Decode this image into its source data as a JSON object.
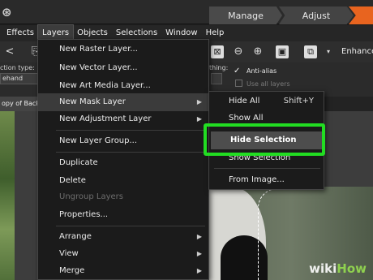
{
  "workspace_tabs": [
    "Manage",
    "Adjust",
    ""
  ],
  "menubar": [
    "Effects",
    "Layers",
    "Objects",
    "Selections",
    "Window",
    "Help"
  ],
  "toolbar": {
    "enhance_label": "Enhance"
  },
  "options": {
    "selection_type_label": "ction type:",
    "selection_type_value": "ehand",
    "things_label": "thing:",
    "anti_alias_label": "Anti-alias",
    "use_all_layers_label": "Use all layers"
  },
  "document_tab": "opy of Backg",
  "layers_menu": {
    "items": [
      {
        "label": "New Raster Layer..."
      },
      {
        "label": "New Vector Layer..."
      },
      {
        "label": "New Art Media Layer..."
      },
      {
        "label": "New Mask Layer",
        "submenu": true
      },
      {
        "label": "New Adjustment Layer",
        "submenu": true
      },
      {
        "label": "New Layer Group..."
      },
      {
        "label": "Duplicate"
      },
      {
        "label": "Delete"
      },
      {
        "label": "Ungroup Layers",
        "disabled": true
      },
      {
        "label": "Properties..."
      },
      {
        "label": "Arrange",
        "submenu": true
      },
      {
        "label": "View",
        "submenu": true
      },
      {
        "label": "Merge",
        "submenu": true
      }
    ]
  },
  "mask_submenu": {
    "items": [
      {
        "label": "Hide All",
        "shortcut": "Shift+Y"
      },
      {
        "label": "Show All",
        "shortcut": ""
      },
      {
        "label": "Hide Selection",
        "shortcut": ""
      },
      {
        "label": "Show Selection",
        "shortcut": ""
      },
      {
        "label": "From Image...",
        "shortcut": ""
      }
    ]
  },
  "watermark": {
    "wiki": "wiki",
    "how": "How"
  },
  "colors": {
    "accent_orange": "#e8641f",
    "highlight_green": "#22dd22"
  }
}
